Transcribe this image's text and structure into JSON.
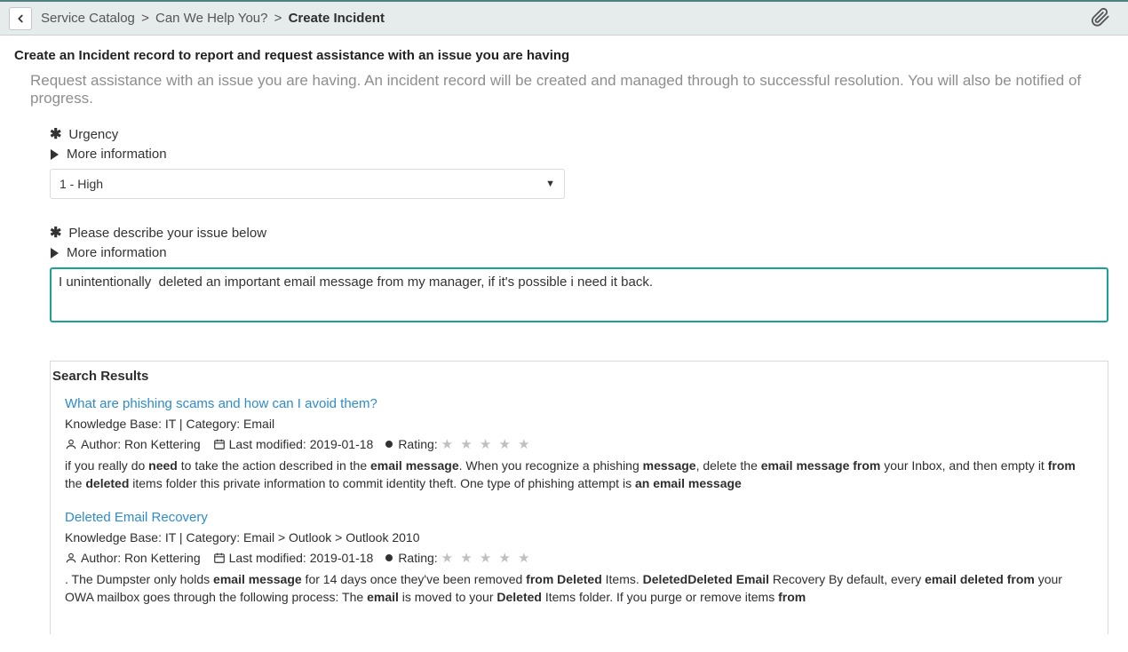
{
  "breadcrumb": {
    "l1": "Service Catalog",
    "l2": "Can We Help You?",
    "l3": "Create Incident"
  },
  "page": {
    "title": "Create an Incident record to report and request assistance with an issue you are having",
    "subtitle": "Request assistance with an issue you are having. An incident record will be created and managed through to successful resolution. You will also be notified of progress."
  },
  "urgency": {
    "label": "Urgency",
    "more_info": "More information",
    "value": "1 - High"
  },
  "describe": {
    "label": "Please describe your issue below",
    "more_info": "More information",
    "value": "I unintentionally  deleted an important email message from my manager, if it's possible i need it back."
  },
  "search": {
    "header": "Search Results",
    "items": [
      {
        "title": "What are phishing scams and how can I avoid them?",
        "kb": "Knowledge Base: IT | Category: Email",
        "author_label": "Author:",
        "author": "Ron Kettering",
        "modified_label": "Last modified:",
        "modified": "2019-01-18",
        "rating_label": "Rating:",
        "snippet_html": "if you really do <b>need</b> to take the action described in the <b>email message</b>. When you recognize a phishing <b>message</b>, delete the <b>email message from</b> your Inbox, and then empty it <b>from</b> the <b>deleted</b> items folder this private information to commit identity theft. One type of phishing attempt is <b>an email message</b>"
      },
      {
        "title": "Deleted Email Recovery",
        "kb": "Knowledge Base: IT | Category: Email > Outlook > Outlook 2010",
        "author_label": "Author:",
        "author": "Ron Kettering",
        "modified_label": "Last modified:",
        "modified": "2019-01-18",
        "rating_label": "Rating:",
        "snippet_html": ". The Dumpster only holds <b>email message</b> for 14 days once they've been removed <b>from Deleted</b> Items. <b>DeletedDeleted Email</b> Recovery By default, every <b>email deleted from</b> your OWA mailbox goes through the following process: The <b>email</b> is moved to your <b>Deleted</b> Items folder. If you purge or remove items <b>from</b>"
      }
    ]
  }
}
